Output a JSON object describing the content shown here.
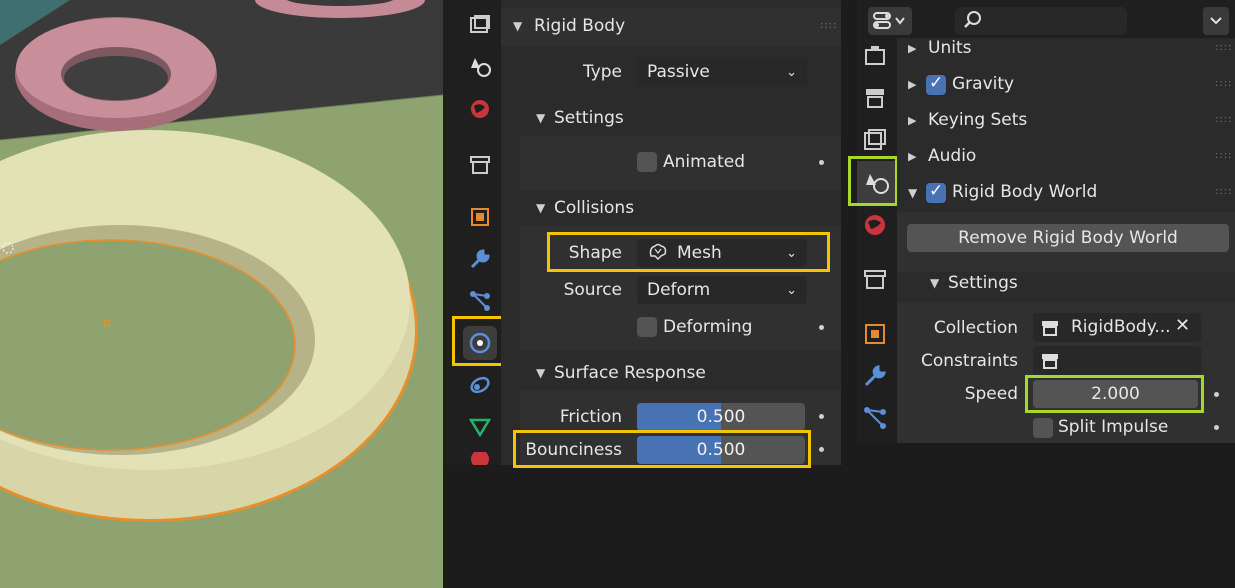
{
  "rigid_body_panel": {
    "title": "Rigid Body",
    "type_label": "Type",
    "type_value": "Passive",
    "settings_label": "Settings",
    "animated_label": "Animated",
    "collisions_label": "Collisions",
    "shape_label": "Shape",
    "shape_value": "Mesh",
    "source_label": "Source",
    "source_value": "Deform",
    "deforming_label": "Deforming",
    "surface_response_label": "Surface Response",
    "friction_label": "Friction",
    "friction_value": "0.500",
    "bounciness_label": "Bounciness",
    "bounciness_value": "0.500"
  },
  "scene_panel": {
    "units_label": "Units",
    "gravity_label": "Gravity",
    "keying_sets_label": "Keying Sets",
    "audio_label": "Audio",
    "rigid_body_world_label": "Rigid Body World",
    "remove_button": "Remove Rigid Body World",
    "settings_label": "Settings",
    "collection_label": "Collection",
    "collection_value": "RigidBody...",
    "constraints_label": "Constraints",
    "speed_label": "Speed",
    "speed_value": "2.000",
    "split_impulse_label": "Split Impulse"
  },
  "colors": {
    "highlight_yellow": "#f5c400",
    "highlight_green": "#a6d72b",
    "accent_blue": "#4772b3"
  }
}
